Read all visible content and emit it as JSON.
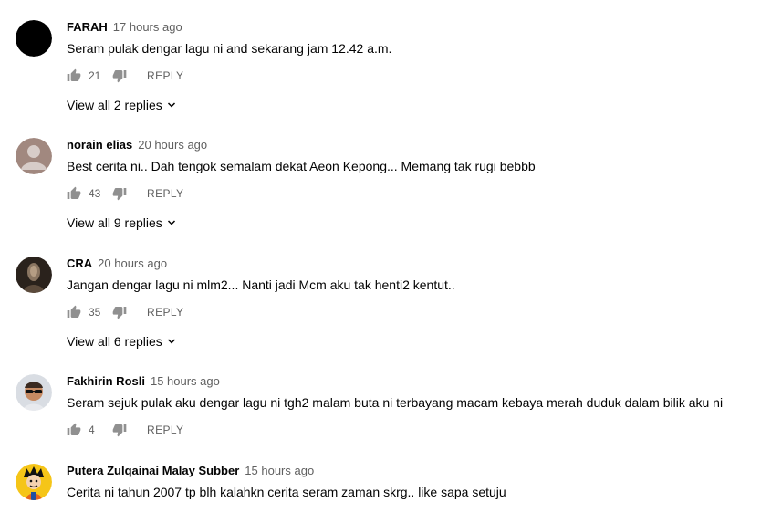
{
  "comments": [
    {
      "author": "FARAH",
      "time": "17 hours ago",
      "text": "Seram pulak dengar lagu ni and sekarang jam 12.42 a.m.",
      "likes": "21",
      "reply_label": "REPLY",
      "view_replies": "View all 2 replies",
      "avatar_color": "#000000"
    },
    {
      "author": "norain elias",
      "time": "20 hours ago",
      "text": "Best cerita ni.. Dah tengok semalam dekat Aeon Kepong... Memang tak rugi bebbb",
      "likes": "43",
      "reply_label": "REPLY",
      "view_replies": "View all 9 replies",
      "avatar_color": "#a1887f"
    },
    {
      "author": "CRA",
      "time": "20 hours ago",
      "text": "Jangan dengar lagu ni mlm2... Nanti jadi Mcm aku tak henti2 kentut..",
      "likes": "35",
      "reply_label": "REPLY",
      "view_replies": "View all 6 replies",
      "avatar_color": "#3b2f25"
    },
    {
      "author": "Fakhirin Rosli",
      "time": "15 hours ago",
      "text": "Seram sejuk pulak aku dengar lagu ni tgh2 malam buta ni terbayang macam kebaya merah duduk dalam bilik aku ni",
      "likes": "4",
      "reply_label": "REPLY",
      "avatar_color": "#d9dde3"
    },
    {
      "author": "Putera Zulqainai Malay Subber",
      "time": "15 hours ago",
      "text": "Cerita ni tahun 2007 tp blh kalahkn cerita seram zaman skrg.. like sapa setuju",
      "avatar_color": "#f5c518"
    }
  ],
  "icons": {
    "like": "thumb-up-icon",
    "dislike": "thumb-down-icon",
    "chevron": "chevron-down-icon"
  },
  "colors": {
    "text_primary": "#030303",
    "text_secondary": "#606060",
    "icon": "#909090"
  }
}
